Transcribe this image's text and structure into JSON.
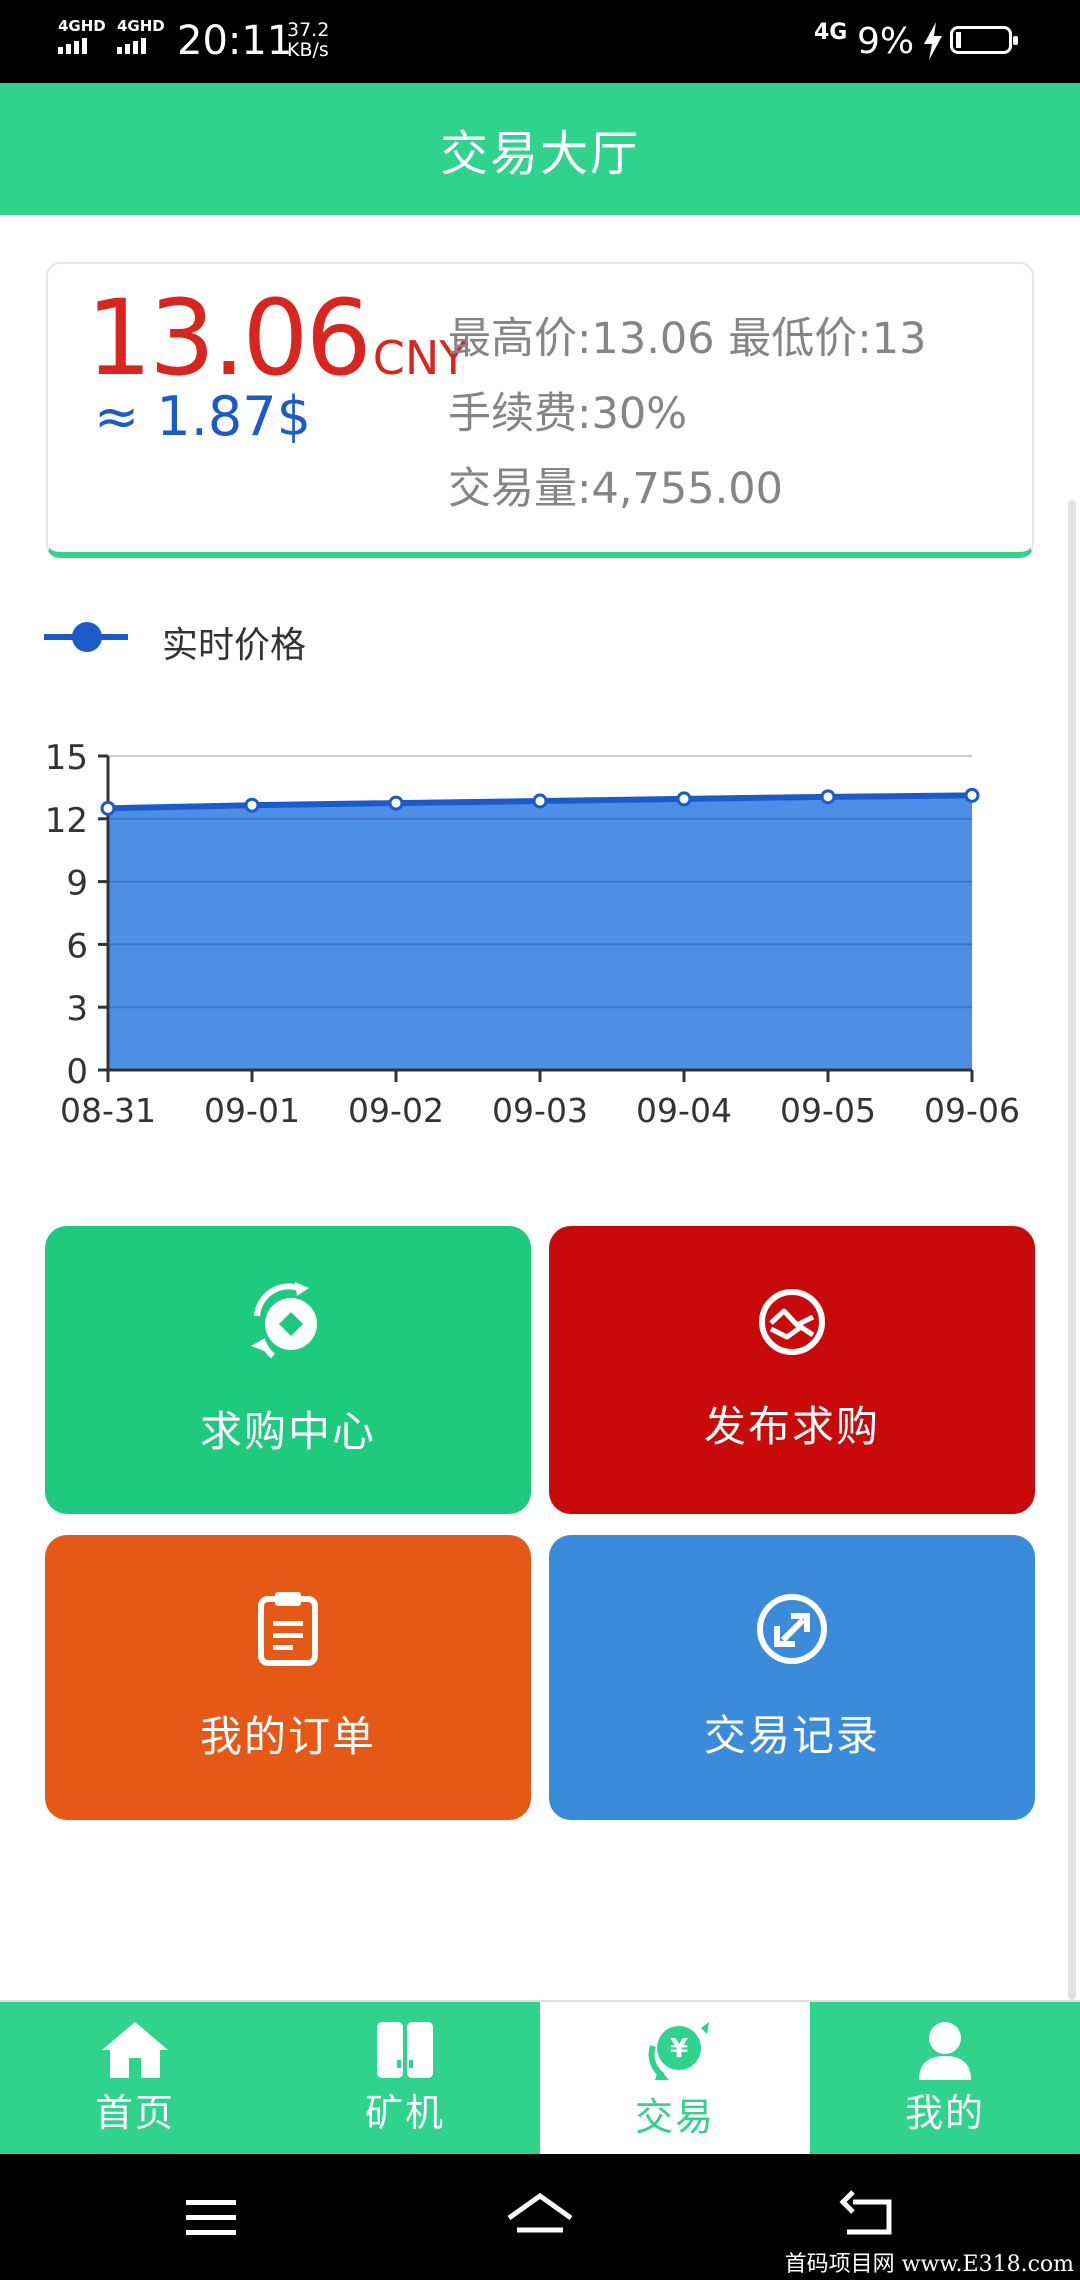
{
  "status_bar": {
    "sim1": "4GHD",
    "sim2": "4GHD",
    "time": "20:11",
    "speed_value": "37.2",
    "speed_unit": "KB/s",
    "network": "4G",
    "battery_pct": "9%",
    "battery_level": 0.09
  },
  "header": {
    "title": "交易大厅"
  },
  "price_card": {
    "price": "13.06",
    "currency": "CNY",
    "usd": "≈ 1.87$",
    "high_low": "最高价:13.06 最低价:13",
    "fee": "手续费:30%",
    "volume": "交易量:4,755.00"
  },
  "chart_data": {
    "type": "area",
    "legend": "实时价格",
    "categories": [
      "08-31",
      "09-01",
      "09-02",
      "09-03",
      "09-04",
      "09-05",
      "09-06"
    ],
    "series": [
      {
        "name": "实时价格",
        "values": [
          12.5,
          12.65,
          12.75,
          12.85,
          12.95,
          13.05,
          13.12
        ]
      }
    ],
    "ylim": [
      0,
      15
    ],
    "yticks": [
      0,
      3,
      6,
      9,
      12,
      15
    ],
    "grid": true,
    "colors": {
      "line": "#1a5bc9",
      "fill": "#4d8fe6"
    }
  },
  "tiles": [
    {
      "label": "求购中心",
      "icon": "coin-exchange-icon",
      "color": "#1ecb7e"
    },
    {
      "label": "发布求购",
      "icon": "exchange-circle-icon",
      "color": "#c80a0b"
    },
    {
      "label": "我的订单",
      "icon": "clipboard-icon",
      "color": "#e55816"
    },
    {
      "label": "交易记录",
      "icon": "swap-arrows-icon",
      "color": "#3b8bdb"
    }
  ],
  "bottom_nav": [
    {
      "label": "首页",
      "icon": "home-icon",
      "active": false
    },
    {
      "label": "矿机",
      "icon": "miner-icon",
      "active": false
    },
    {
      "label": "交易",
      "icon": "yen-exchange-icon",
      "active": true
    },
    {
      "label": "我的",
      "icon": "user-icon",
      "active": false
    }
  ],
  "watermark": "首码项目网 www.E318.com",
  "colors": {
    "brand_green": "#2fd38b",
    "price_red": "#d8261e",
    "usd_blue": "#1a5bc9"
  }
}
